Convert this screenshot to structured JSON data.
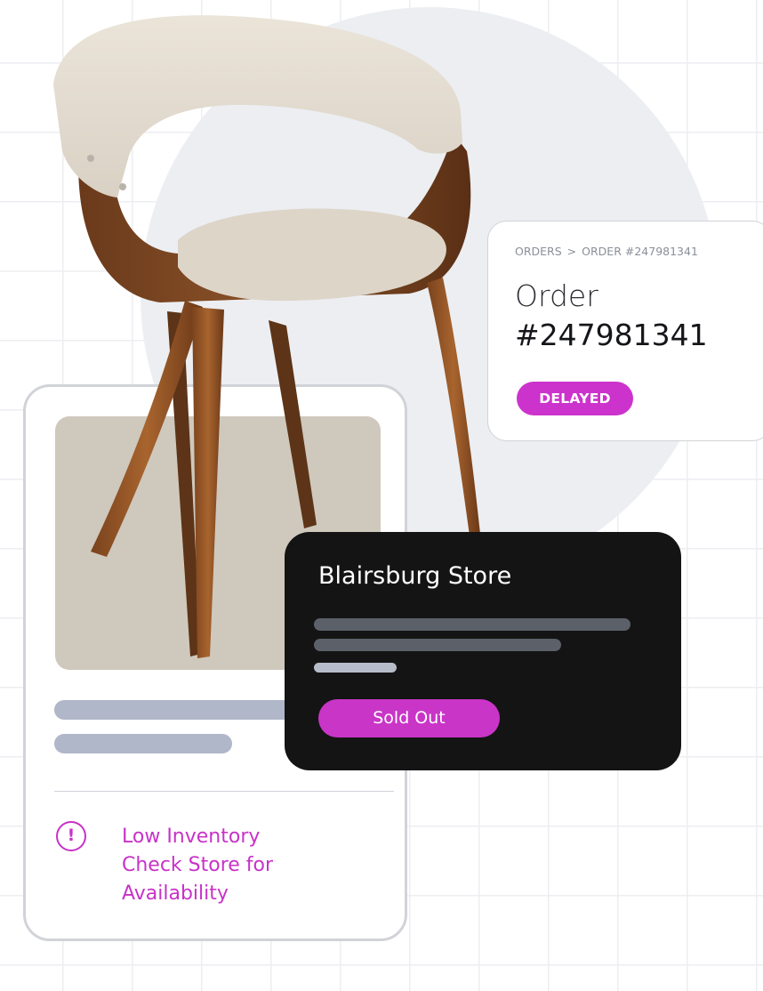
{
  "product_card": {
    "alert_icon_glyph": "!",
    "alert_lines": [
      "Low Inventory",
      "Check Store for",
      "Availability"
    ]
  },
  "order_card": {
    "breadcrumb": [
      "ORDERS",
      "ORDER #247981341"
    ],
    "breadcrumb_separator": ">",
    "title_prefix": "Order",
    "order_number": "#247981341",
    "status": "DELAYED"
  },
  "store_card": {
    "store_name": "Blairsburg Store",
    "status": "Sold Out"
  },
  "icons": {
    "alert": "exclamation-circle-icon",
    "breadcrumb_separator": "chevron-right-icon"
  },
  "colors": {
    "accent": "#cc33cc",
    "store_card_bg": "#141414",
    "placeholder_bar": "#b0b7c8",
    "grid_line": "#eceef2"
  }
}
